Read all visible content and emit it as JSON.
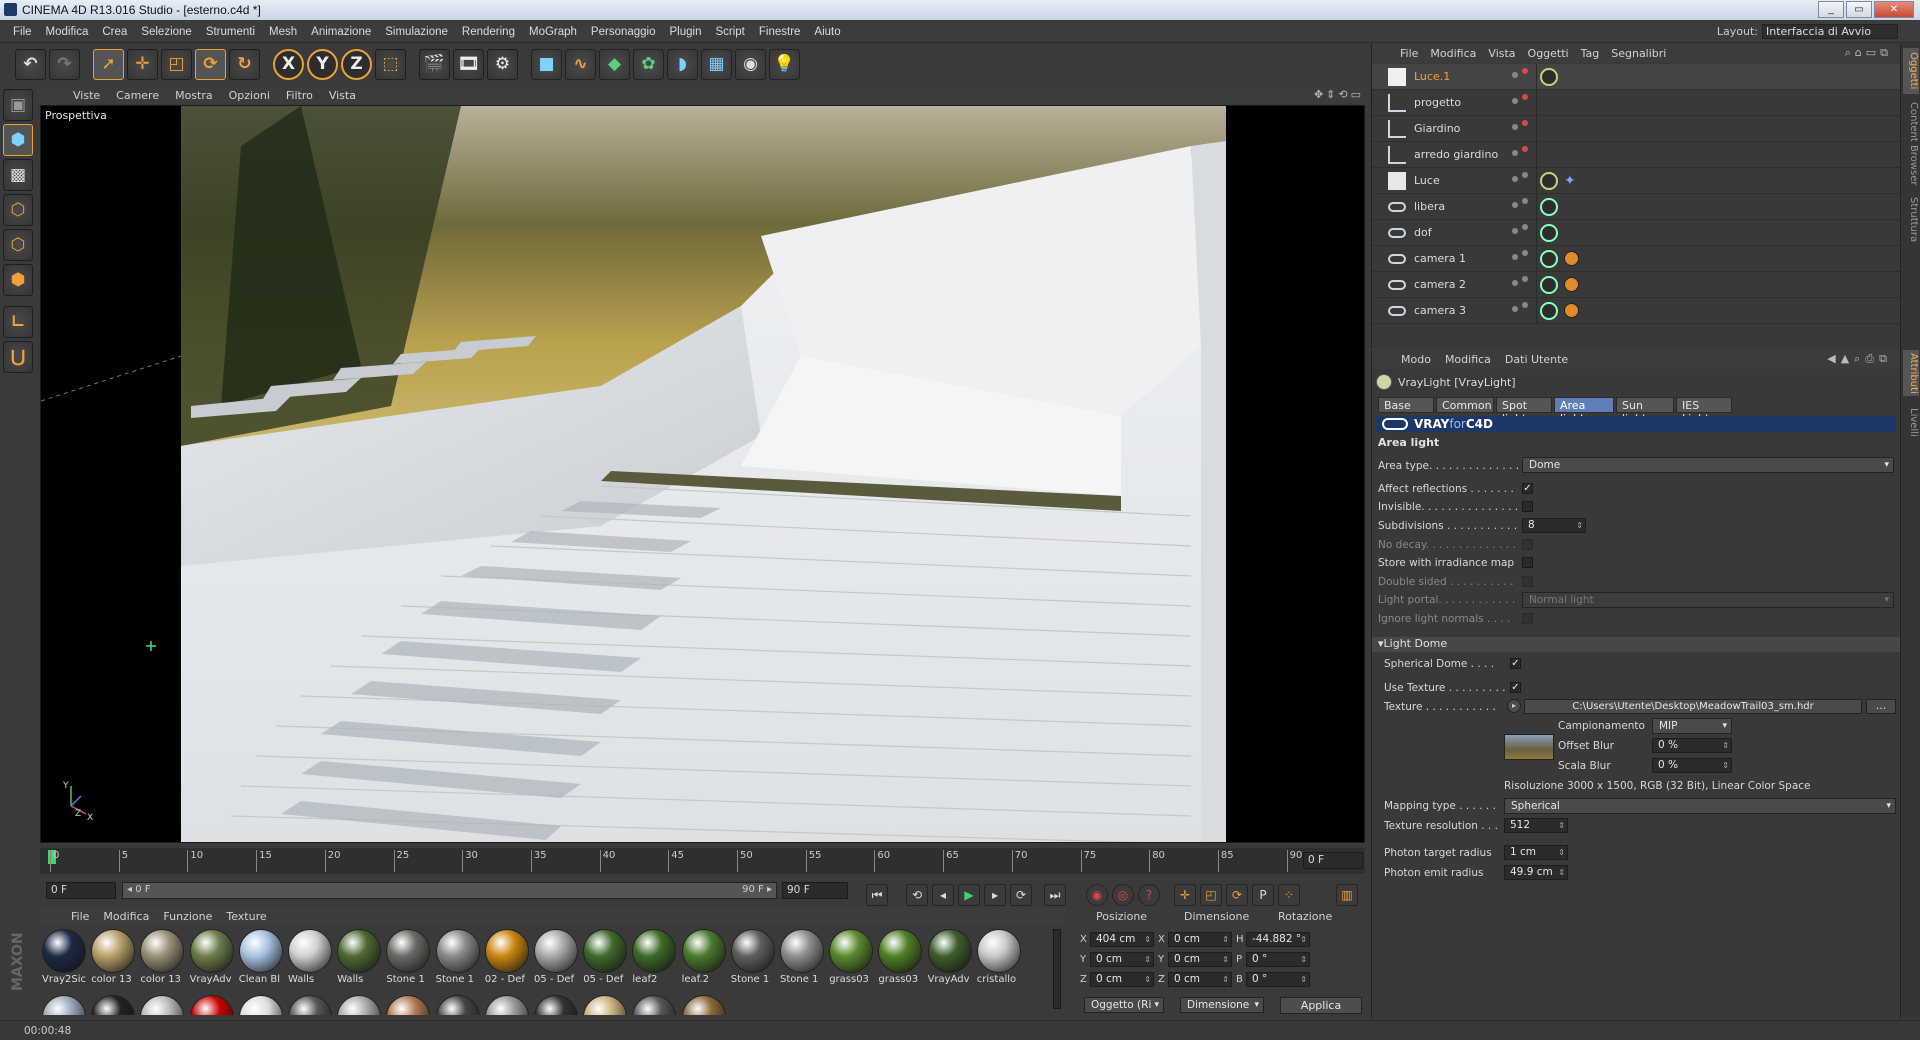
{
  "window": {
    "title": "CINEMA 4D R13.016 Studio - [esterno.c4d *]",
    "buttons": [
      "_",
      "▭",
      "✕"
    ]
  },
  "menubar": {
    "items": [
      "File",
      "Modifica",
      "Crea",
      "Selezione",
      "Strumenti",
      "Mesh",
      "Animazione",
      "Simulazione",
      "Rendering",
      "MoGraph",
      "Personaggio",
      "Plugin",
      "Script",
      "Finestre",
      "Aiuto"
    ],
    "layout_label": "Layout:",
    "layout_value": "Interfaccia di Avvio"
  },
  "viewport": {
    "menu": [
      "Viste",
      "Camere",
      "Mostra",
      "Opzioni",
      "Filtro",
      "Vista"
    ],
    "label": "Prospettiva",
    "axis": {
      "x": "X",
      "y": "Y",
      "z": "Z"
    }
  },
  "timeline": {
    "ticks": [
      "0",
      "5",
      "10",
      "15",
      "20",
      "25",
      "30",
      "35",
      "40",
      "45",
      "50",
      "55",
      "60",
      "65",
      "70",
      "75",
      "80",
      "85",
      "90"
    ],
    "current_frame": "0 F",
    "start_field": "0 F",
    "range_left": "◂ 0 F",
    "range_right": "90 F ▸",
    "end_field": "90 F"
  },
  "materials": {
    "menu": [
      "File",
      "Modifica",
      "Funzione",
      "Texture"
    ],
    "items": [
      {
        "label": "Vray2Sic",
        "color": "#1d2a44"
      },
      {
        "label": "color 13",
        "color": "#b7a06a"
      },
      {
        "label": "color 13",
        "color": "#9a8f77"
      },
      {
        "label": "VrayAdv",
        "color": "#6b7e4a"
      },
      {
        "label": "Clean Bl",
        "color": "#a7c3e0"
      },
      {
        "label": "Walls",
        "color": "#cfcfcf"
      },
      {
        "label": "Walls",
        "color": "#4d6a32"
      },
      {
        "label": "Stone 1",
        "color": "#6a6a66"
      },
      {
        "label": "Stone 1",
        "color": "#8a8a88"
      },
      {
        "label": "02 - Def",
        "color": "#c9860f"
      },
      {
        "label": "05 - Def",
        "color": "#a9a9a9"
      },
      {
        "label": "05 - Def",
        "color": "#3f6a2a"
      },
      {
        "label": "leaf2",
        "color": "#3e6a26"
      },
      {
        "label": "leaf.2",
        "color": "#4a7a2e"
      },
      {
        "label": "Stone 1",
        "color": "#5f5f5c"
      },
      {
        "label": "Stone 1",
        "color": "#8e8e8e"
      },
      {
        "label": "grass03",
        "color": "#5a8a2c"
      },
      {
        "label": "grass03",
        "color": "#4f8025"
      },
      {
        "label": "VrayAdv",
        "color": "#3d5d2a"
      },
      {
        "label": "cristallo",
        "color": "#c8c8c8"
      }
    ],
    "row2_colors": [
      "#9ab",
      "#222",
      "#bbb",
      "#c00",
      "#ddd",
      "#555",
      "#aaa",
      "#b07a50",
      "#444",
      "#999",
      "#333",
      "#c8b07a",
      "#555",
      "#8a6a3a"
    ]
  },
  "coords": {
    "headers": [
      "Posizione",
      "Dimensione",
      "Rotazione"
    ],
    "pos": [
      {
        "axis": "X",
        "value": "404 cm"
      },
      {
        "axis": "Y",
        "value": "0 cm"
      },
      {
        "axis": "Z",
        "value": "0 cm"
      }
    ],
    "dim": [
      {
        "axis": "X",
        "value": "0 cm"
      },
      {
        "axis": "Y",
        "value": "0 cm"
      },
      {
        "axis": "Z",
        "value": "0 cm"
      }
    ],
    "rot": [
      {
        "axis": "H",
        "value": "-44.882 °"
      },
      {
        "axis": "P",
        "value": "0 °"
      },
      {
        "axis": "B",
        "value": "0 °"
      }
    ],
    "mode1": "Oggetto (Ri",
    "mode2": "Dimensione",
    "apply": "Applica"
  },
  "objects": {
    "menu": [
      "File",
      "Modifica",
      "Vista",
      "Oggetti",
      "Tag",
      "Segnalibri"
    ],
    "rows": [
      {
        "name": "Luce.1",
        "selected": true,
        "icon": "white"
      },
      {
        "name": "progetto",
        "icon": "null"
      },
      {
        "name": "Giardino",
        "icon": "null"
      },
      {
        "name": "arredo giardino",
        "icon": "null"
      },
      {
        "name": "Luce",
        "icon": "light"
      },
      {
        "name": "libera",
        "icon": "camera"
      },
      {
        "name": "dof",
        "icon": "camera"
      },
      {
        "name": "camera 1",
        "icon": "camera"
      },
      {
        "name": "camera 2",
        "icon": "camera"
      },
      {
        "name": "camera 3",
        "icon": "camera"
      }
    ]
  },
  "attributes": {
    "menu": [
      "Modo",
      "Modifica",
      "Dati Utente"
    ],
    "object_title": "VrayLight [VrayLight]",
    "tabs": [
      "Base",
      "Common",
      "Spot light",
      "Area light",
      "Sun light",
      "IES Light"
    ],
    "active_tab": "Area light",
    "banner_vray": "VRAY",
    "banner_for": "for",
    "banner_c4d": "C4D",
    "section_title": "Area light",
    "area_type_label": "Area type. . . . . . . . . . . . . .",
    "area_type_value": "Dome",
    "affect_reflections": "Affect reflections . . . . . . .",
    "invisible": "Invisible. . . . . . . . . . . . . . .",
    "subdivisions": "Subdivisions . . . . . . . . . . .",
    "subdivisions_value": "8",
    "no_decay": "No decay. . . . . . . . . . . . . .",
    "store_irradiance": "Store with irradiance map",
    "double_sided": "Double sided . . . . . . . . . .",
    "light_portal": "Light portal. . . . . . . . . . . .",
    "light_portal_value": "Normal light",
    "ignore_normals": "Ignore light normals . . . .",
    "dome_section": "▾Light Dome",
    "spherical_dome": "Spherical Dome . . . .",
    "use_texture": "Use Texture . . . . . . . . .",
    "texture": "Texture . . . . . . . . . . .",
    "texture_path": "C:\\Users\\Utente\\Desktop\\MeadowTrail03_sm.hdr",
    "texture_more": "...",
    "campionamento": "Campionamento",
    "campionamento_value": "MIP",
    "offset_blur": "Offset Blur",
    "offset_blur_value": "0 %",
    "scala_blur": "Scala Blur",
    "scala_blur_value": "0 %",
    "resolution_info": "Risoluzione 3000 x 1500, RGB (32 Bit), Linear Color Space",
    "mapping_type": "Mapping type . . . . . .",
    "mapping_type_value": "Spherical",
    "texture_resolution": "Texture resolution . . .",
    "texture_resolution_value": "512",
    "photon_target": "Photon target radius",
    "photon_target_value": "1 cm",
    "photon_emit": "Photon emit radius",
    "photon_emit_value": "49.9 cm"
  },
  "right_tabs": [
    "Oggetti",
    "Content Browser",
    "Struttura",
    "Attributi",
    "Livelli"
  ],
  "status": {
    "time": "00:00:48",
    "brand": "MAXON CINEMA 4D"
  }
}
